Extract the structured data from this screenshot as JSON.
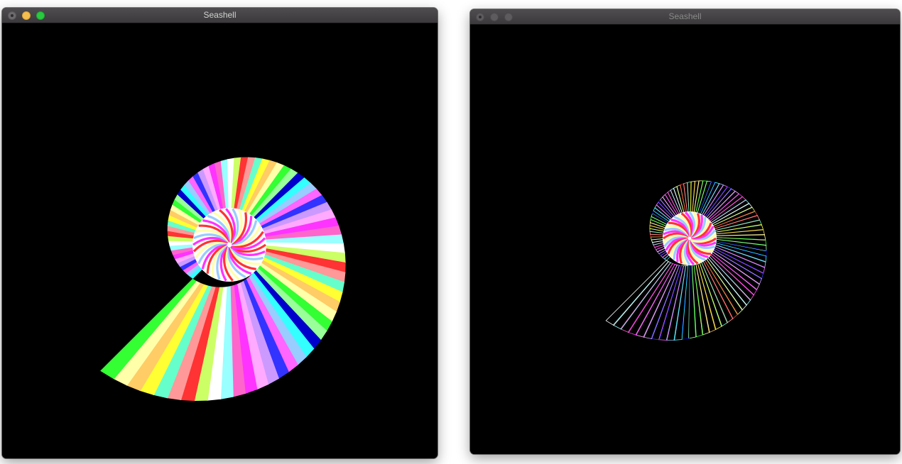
{
  "windows": [
    {
      "title": "Seashell",
      "state": "active",
      "render_mode": "solid",
      "traffic_colors": {
        "close": "#6c6a6c",
        "minimize": "#f5bf4f",
        "zoom": "#29c940"
      }
    },
    {
      "title": "Seashell",
      "state": "inactive",
      "render_mode": "wireframe",
      "traffic_colors": {
        "close": "#5d5b5d",
        "minimize": "#5d5b5d",
        "zoom": "#5d5b5d"
      }
    }
  ],
  "palette": [
    "#ff3333",
    "#ffff33",
    "#33ff33",
    "#33ffff",
    "#3333ff",
    "#ff33ff",
    "#ffffff",
    "#ff9999",
    "#ffcc66",
    "#99ff99",
    "#99ccff",
    "#cc99ff",
    "#ff66cc",
    "#ccff66",
    "#66ffcc",
    "#ffffaa",
    "#0000cc",
    "#ff66ff",
    "#ffaaff",
    "#99ffff"
  ],
  "icons": {
    "close": "close-icon",
    "minimize": "minimize-icon",
    "zoom": "zoom-icon"
  }
}
